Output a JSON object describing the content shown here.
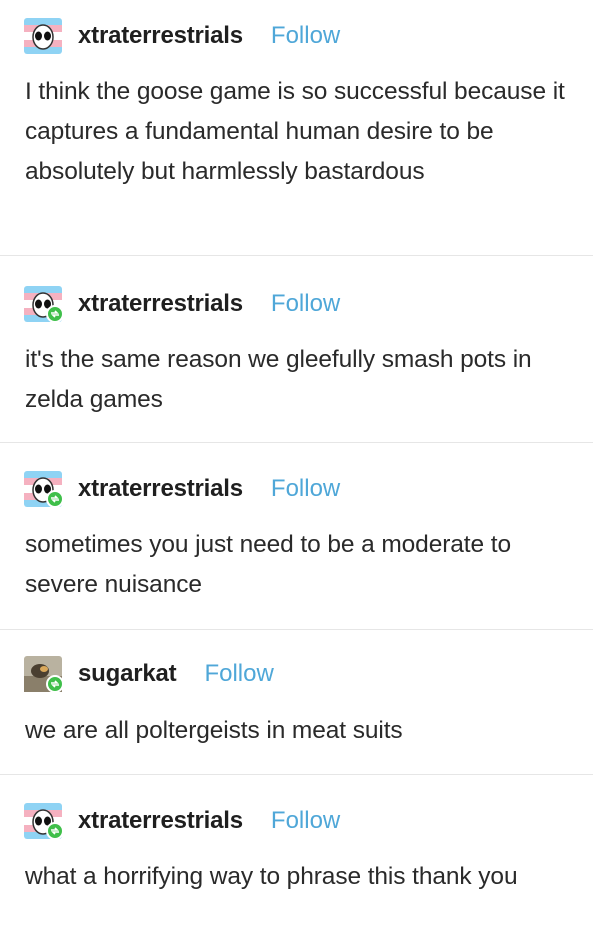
{
  "posts": [
    {
      "username": "xtraterrestrials",
      "follow_label": "Follow",
      "avatar_icon": "alien-icon",
      "reblogged": false,
      "text": "I think the goose game is so successful because it captures a fundamental human desire to be absolutely but harmlessly bastardous"
    },
    {
      "username": "xtraterrestrials",
      "follow_label": "Follow",
      "avatar_icon": "alien-icon",
      "reblogged": true,
      "text": "it's the same reason we gleefully smash pots in zelda games"
    },
    {
      "username": "xtraterrestrials",
      "follow_label": "Follow",
      "avatar_icon": "alien-icon",
      "reblogged": true,
      "text": "sometimes you just need to be a moderate to severe nuisance"
    },
    {
      "username": "sugarkat",
      "follow_label": "Follow",
      "avatar_icon": "photo-avatar-icon",
      "reblogged": true,
      "text": "we are all poltergeists in meat suits"
    },
    {
      "username": "xtraterrestrials",
      "follow_label": "Follow",
      "avatar_icon": "alien-icon",
      "reblogged": true,
      "text": "what a horrifying way to phrase this thank you"
    }
  ],
  "colors": {
    "follow": "#4fa7d8",
    "reblog_badge": "#3fbf4a",
    "divider": "#e6e6e6",
    "flag_blue": "#8fd3f4",
    "flag_pink": "#f5b1c0"
  }
}
